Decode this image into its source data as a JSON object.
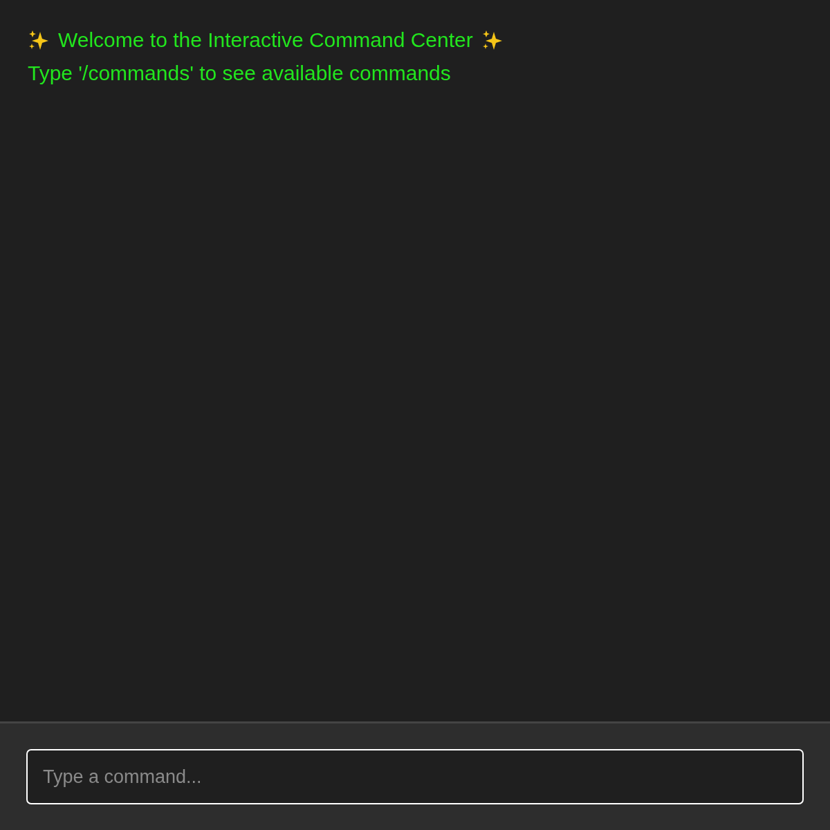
{
  "output": [
    {
      "kind": "banner",
      "text": "Welcome to the Interactive Command Center"
    },
    {
      "kind": "line",
      "text": "Type '/commands' to see available commands"
    }
  ],
  "command_input": {
    "placeholder": "Type a command..."
  }
}
